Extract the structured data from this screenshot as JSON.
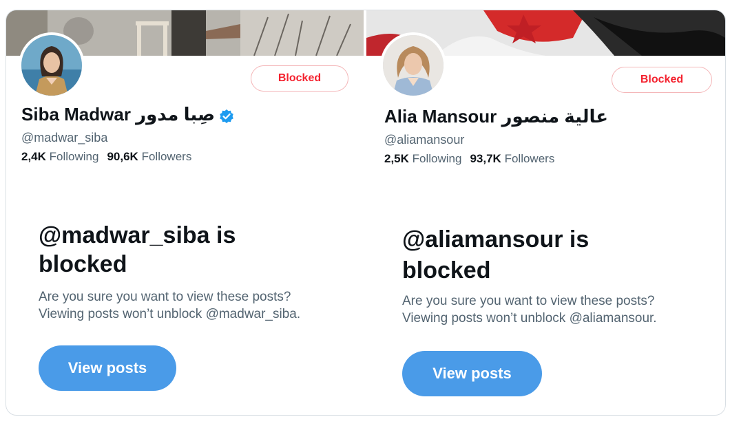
{
  "profiles": [
    {
      "name": "Siba Madwar صِبا مدور",
      "handle": "@madwar_siba",
      "following_count": "2,4K",
      "following_label": "Following",
      "followers_count": "90,6K",
      "followers_label": "Followers",
      "blocked_label": "Blocked",
      "headline": "@madwar_siba is blocked",
      "sub_line1": "Are you sure you want to view these posts?",
      "sub_line2": "Viewing posts won’t unblock @madwar_siba.",
      "view_label": "View posts",
      "verified": true
    },
    {
      "name": "Alia Mansour عالية منصور",
      "handle": "@aliamansour",
      "following_count": "2,5K",
      "following_label": "Following",
      "followers_count": "93,7K",
      "followers_label": "Followers",
      "blocked_label": "Blocked",
      "headline": "@aliamansour is blocked",
      "sub_line1": "Are you sure you want to view these posts?",
      "sub_line2": "Viewing posts won’t unblock @aliamansour.",
      "view_label": "View posts",
      "verified": false
    }
  ],
  "colors": {
    "accent": "#4a9be8",
    "blocked_red": "#f4212e",
    "verified_blue": "#1d9bf0",
    "text_primary": "#0f1419",
    "text_secondary": "#536471"
  }
}
